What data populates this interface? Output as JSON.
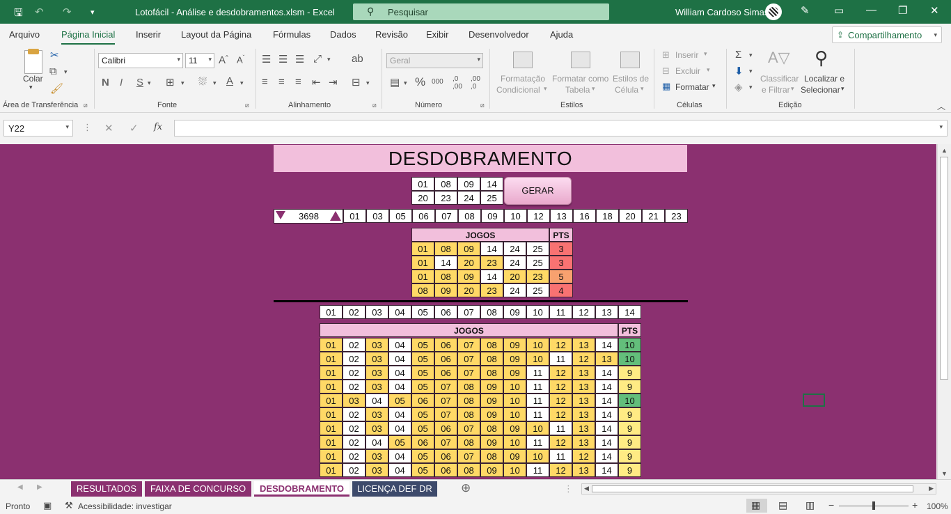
{
  "titlebar": {
    "doc_title": "Lotofácil - Análise e desdobramentos.xlsm  -  Excel",
    "search_label": "Pesquisar",
    "user_name": "William Cardoso Simas"
  },
  "menu": {
    "tabs": [
      "Arquivo",
      "Página Inicial",
      "Inserir",
      "Layout da Página",
      "Fórmulas",
      "Dados",
      "Revisão",
      "Exibir",
      "Desenvolvedor",
      "Ajuda"
    ],
    "share_label": "Compartilhamento"
  },
  "ribbon": {
    "clipboard": {
      "paste": "Colar",
      "group": "Área de Transferência"
    },
    "font": {
      "name": "Calibri",
      "size": "11",
      "bold": "N",
      "italic": "I",
      "underline": "S",
      "group": "Fonte"
    },
    "alignment": {
      "group": "Alinhamento"
    },
    "number": {
      "format": "Geral",
      "group": "Número"
    },
    "styles": {
      "cond_format_1": "Formatação",
      "cond_format_2": "Condicional",
      "table_1": "Formatar como",
      "table_2": "Tabela",
      "cell_styles_1": "Estilos de",
      "cell_styles_2": "Célula",
      "group": "Estilos"
    },
    "cells": {
      "insert": "Inserir",
      "delete": "Excluir",
      "format": "Formatar",
      "group": "Células"
    },
    "editing": {
      "sort_1": "Classificar",
      "sort_2": "e Filtrar",
      "find_1": "Localizar e",
      "find_2": "Selecionar",
      "group": "Edição"
    }
  },
  "formulabar": {
    "namebox": "Y22",
    "fx": "fx",
    "value": ""
  },
  "sheet": {
    "title": "DESDOBRAMENTO",
    "selected_numbers_row1": [
      "01",
      "08",
      "09",
      "14"
    ],
    "selected_numbers_row2": [
      "20",
      "23",
      "24",
      "25"
    ],
    "gerar_label": "GERAR",
    "counter": "3698",
    "draw_numbers": [
      "01",
      "03",
      "05",
      "06",
      "07",
      "08",
      "09",
      "10",
      "12",
      "13",
      "16",
      "18",
      "20",
      "21",
      "23"
    ],
    "jogos_label": "JOGOS",
    "pts_label": "PTS",
    "top_games": [
      {
        "nums": [
          "01",
          "08",
          "09",
          "14",
          "24",
          "25"
        ],
        "cls": [
          "y",
          "y",
          "y",
          "w",
          "w",
          "w"
        ],
        "pts": "3",
        "pcls": "r"
      },
      {
        "nums": [
          "01",
          "14",
          "20",
          "23",
          "24",
          "25"
        ],
        "cls": [
          "y",
          "w",
          "y",
          "y",
          "w",
          "w"
        ],
        "pts": "3",
        "pcls": "r"
      },
      {
        "nums": [
          "01",
          "08",
          "09",
          "14",
          "20",
          "23"
        ],
        "cls": [
          "y",
          "y",
          "y",
          "w",
          "y",
          "y"
        ],
        "pts": "5",
        "pcls": "o"
      },
      {
        "nums": [
          "08",
          "09",
          "20",
          "23",
          "24",
          "25"
        ],
        "cls": [
          "y",
          "y",
          "y",
          "y",
          "w",
          "w"
        ],
        "pts": "4",
        "pcls": "r"
      }
    ],
    "base_numbers": [
      "01",
      "02",
      "03",
      "04",
      "05",
      "06",
      "07",
      "08",
      "09",
      "10",
      "11",
      "12",
      "13",
      "14"
    ],
    "games": [
      {
        "nums": [
          "01",
          "02",
          "03",
          "04",
          "05",
          "06",
          "07",
          "08",
          "09",
          "10",
          "12",
          "13",
          "14"
        ],
        "cls": [
          "y",
          "w",
          "y",
          "w",
          "y",
          "y",
          "y",
          "y",
          "y",
          "y",
          "y",
          "y",
          "w"
        ],
        "pts": "10",
        "pcls": "g"
      },
      {
        "nums": [
          "01",
          "02",
          "03",
          "04",
          "05",
          "06",
          "07",
          "08",
          "09",
          "10",
          "11",
          "12",
          "13"
        ],
        "cls": [
          "y",
          "w",
          "y",
          "w",
          "y",
          "y",
          "y",
          "y",
          "y",
          "y",
          "w",
          "y",
          "y"
        ],
        "pts": "10",
        "pcls": "g"
      },
      {
        "nums": [
          "01",
          "02",
          "03",
          "04",
          "05",
          "06",
          "07",
          "08",
          "09",
          "11",
          "12",
          "13",
          "14"
        ],
        "cls": [
          "y",
          "w",
          "y",
          "w",
          "y",
          "y",
          "y",
          "y",
          "y",
          "w",
          "y",
          "y",
          "w"
        ],
        "pts": "9",
        "pcls": "lg"
      },
      {
        "nums": [
          "01",
          "02",
          "03",
          "04",
          "05",
          "07",
          "08",
          "09",
          "10",
          "11",
          "12",
          "13",
          "14"
        ],
        "cls": [
          "y",
          "w",
          "y",
          "w",
          "y",
          "y",
          "y",
          "y",
          "y",
          "w",
          "y",
          "y",
          "w"
        ],
        "pts": "9",
        "pcls": "lg"
      },
      {
        "nums": [
          "01",
          "03",
          "04",
          "05",
          "06",
          "07",
          "08",
          "09",
          "10",
          "11",
          "12",
          "13",
          "14"
        ],
        "cls": [
          "y",
          "y",
          "w",
          "y",
          "y",
          "y",
          "y",
          "y",
          "y",
          "w",
          "y",
          "y",
          "w"
        ],
        "pts": "10",
        "pcls": "g"
      },
      {
        "nums": [
          "01",
          "02",
          "03",
          "04",
          "05",
          "07",
          "08",
          "09",
          "10",
          "11",
          "12",
          "13",
          "14"
        ],
        "cls": [
          "y",
          "w",
          "y",
          "w",
          "y",
          "y",
          "y",
          "y",
          "y",
          "w",
          "y",
          "y",
          "w"
        ],
        "pts": "9",
        "pcls": "lg"
      },
      {
        "nums": [
          "01",
          "02",
          "03",
          "04",
          "05",
          "06",
          "07",
          "08",
          "09",
          "10",
          "11",
          "13",
          "14"
        ],
        "cls": [
          "y",
          "w",
          "y",
          "w",
          "y",
          "y",
          "y",
          "y",
          "y",
          "y",
          "w",
          "y",
          "w"
        ],
        "pts": "9",
        "pcls": "lg"
      },
      {
        "nums": [
          "01",
          "02",
          "04",
          "05",
          "06",
          "07",
          "08",
          "09",
          "10",
          "11",
          "12",
          "13",
          "14"
        ],
        "cls": [
          "y",
          "w",
          "w",
          "y",
          "y",
          "y",
          "y",
          "y",
          "y",
          "w",
          "y",
          "y",
          "w"
        ],
        "pts": "9",
        "pcls": "lg"
      },
      {
        "nums": [
          "01",
          "02",
          "03",
          "04",
          "05",
          "06",
          "07",
          "08",
          "09",
          "10",
          "11",
          "12",
          "14"
        ],
        "cls": [
          "y",
          "w",
          "y",
          "w",
          "y",
          "y",
          "y",
          "y",
          "y",
          "y",
          "w",
          "y",
          "w"
        ],
        "pts": "9",
        "pcls": "lg"
      },
      {
        "nums": [
          "01",
          "02",
          "03",
          "04",
          "05",
          "06",
          "08",
          "09",
          "10",
          "11",
          "12",
          "13",
          "14"
        ],
        "cls": [
          "y",
          "w",
          "y",
          "w",
          "y",
          "y",
          "y",
          "y",
          "y",
          "w",
          "y",
          "y",
          "w"
        ],
        "pts": "9",
        "pcls": "lg"
      }
    ]
  },
  "sheet_tabs": [
    {
      "label": "RESULTADOS",
      "color": "#8b3070"
    },
    {
      "label": "FAIXA DE CONCURSO",
      "color": "#8b3070"
    },
    {
      "label": "DESDOBRAMENTO",
      "color": "#ffffff"
    },
    {
      "label": "LICENÇA DEF DR",
      "color": "#3d4a6b"
    }
  ],
  "status": {
    "ready": "Pronto",
    "accessibility": "Acessibilidade: investigar",
    "zoom": "100%"
  }
}
